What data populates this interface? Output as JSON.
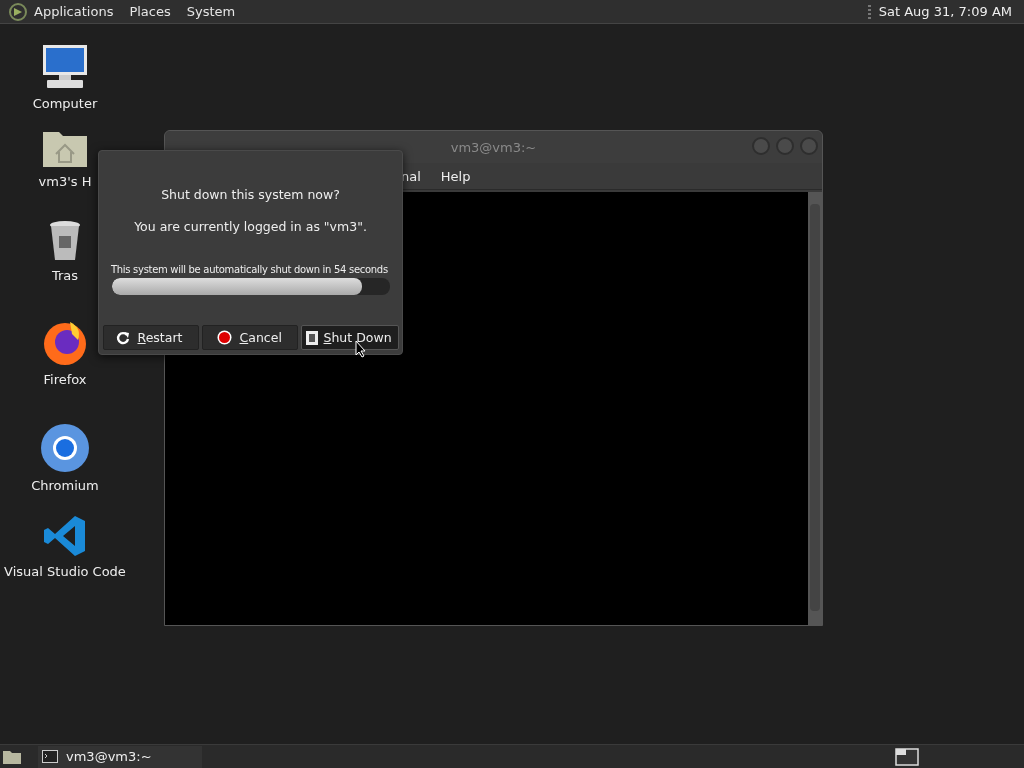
{
  "top_panel": {
    "menus": [
      "Applications",
      "Places",
      "System"
    ],
    "clock": "Sat Aug 31,  7:09 AM"
  },
  "desktop_icons": [
    {
      "kind": "computer",
      "label": "Computer"
    },
    {
      "kind": "home",
      "label": "vm3's H"
    },
    {
      "kind": "trash",
      "label": "Tras"
    },
    {
      "kind": "firefox",
      "label": "Firefox"
    },
    {
      "kind": "chromium",
      "label": "Chromium"
    },
    {
      "kind": "vscode",
      "label": "Visual Studio Code"
    }
  ],
  "terminal": {
    "title": "vm3@vm3:~",
    "menus": [
      "nal",
      "Help"
    ]
  },
  "dialog": {
    "heading": "Shut down this system now?",
    "message": "You are currently logged in as \"vm3\".",
    "countdown": "This system will be automatically shut down in 54 seconds",
    "progress": {
      "level": 0.9
    },
    "buttons": [
      {
        "kind": "restart",
        "label": "Restart",
        "selected": false
      },
      {
        "kind": "cancel",
        "label": "Cancel",
        "selected": false
      },
      {
        "kind": "shutdown",
        "label": "Shut Down",
        "selected": true
      }
    ]
  },
  "taskbar": {
    "tasks": [
      {
        "label": "vm3@vm3:~"
      }
    ]
  }
}
